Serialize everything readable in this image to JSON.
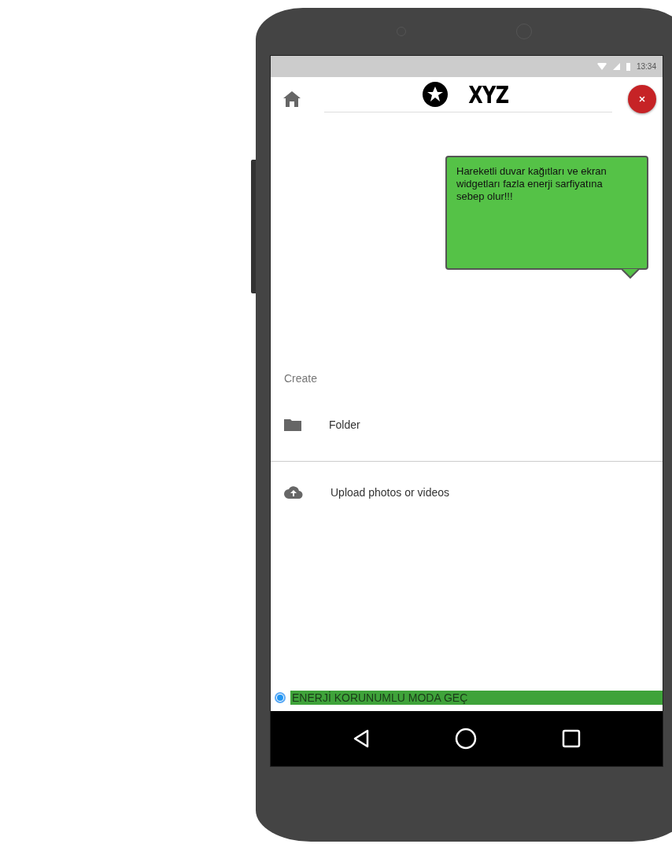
{
  "status_bar": {
    "time": "13:34"
  },
  "header": {
    "title": "XYZ"
  },
  "tooltip": {
    "text": "Hareketli duvar kağıtları ve ekran widgetları fazla enerji sarfiyatına sebep olur!!!"
  },
  "menu": {
    "heading": "Create",
    "items": [
      {
        "kind": "folder",
        "label": "Folder"
      },
      {
        "kind": "upload",
        "label": "Upload photos or videos"
      }
    ]
  },
  "power_option": {
    "label": "ENERJİ KORUNUMLU MODA GEÇ",
    "selected": true
  }
}
